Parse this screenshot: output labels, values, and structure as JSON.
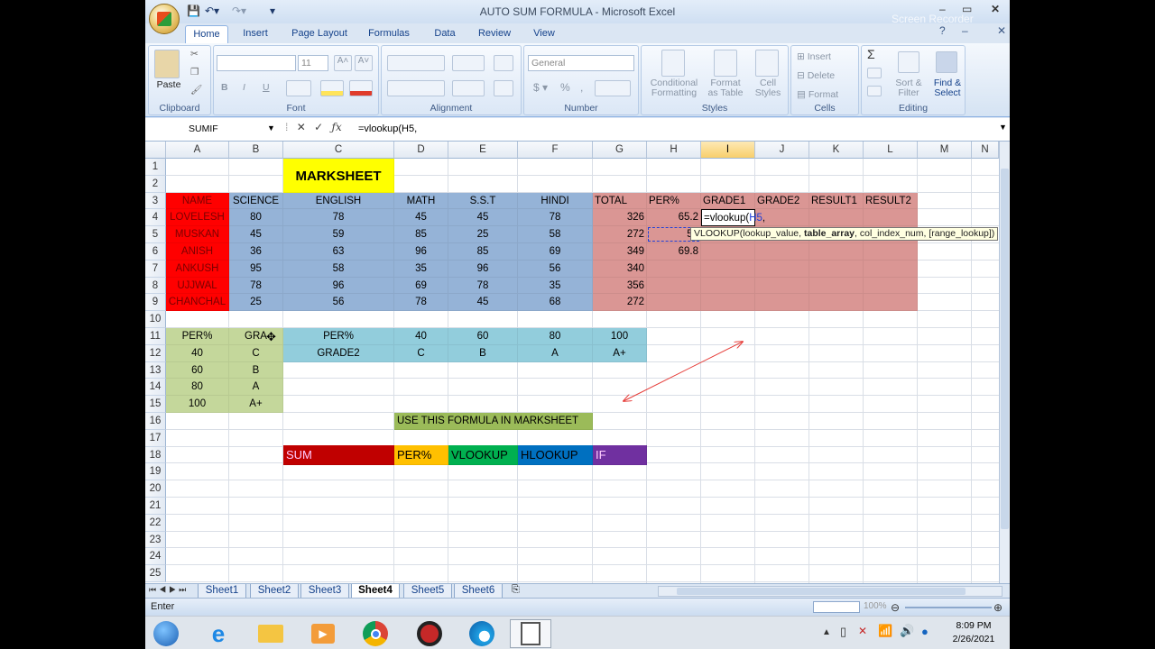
{
  "window": {
    "title": "AUTO SUM FORMULA - Microsoft Excel",
    "watermark": "Screen Recorder"
  },
  "tabs": [
    "Home",
    "Insert",
    "Page Layout",
    "Formulas",
    "Data",
    "Review",
    "View"
  ],
  "ribbon": {
    "clipboard": {
      "label": "Clipboard",
      "paste": "Paste"
    },
    "font": {
      "label": "Font",
      "size": "11",
      "bold": "B",
      "italic": "I",
      "underline": "U"
    },
    "alignment": {
      "label": "Alignment"
    },
    "number": {
      "label": "Number",
      "format": "General"
    },
    "styles": {
      "label": "Styles",
      "conditional": "Conditional Formatting",
      "format_table": "Format as Table",
      "cell_styles": "Cell Styles"
    },
    "cells": {
      "label": "Cells",
      "insert": "Insert",
      "delete": "Delete",
      "format": "Format"
    },
    "editing": {
      "label": "Editing",
      "sort": "Sort & Filter",
      "find": "Find & Select"
    }
  },
  "formula_bar": {
    "name_box": "SUMIF",
    "formula": "=vlookup(H5,"
  },
  "columns": [
    "A",
    "B",
    "C",
    "D",
    "E",
    "F",
    "G",
    "H",
    "I",
    "J",
    "K",
    "L",
    "M",
    "N"
  ],
  "rows": [
    "1",
    "2",
    "3",
    "4",
    "5",
    "6",
    "7",
    "8",
    "9",
    "10",
    "11",
    "12",
    "13",
    "14",
    "15",
    "16",
    "17",
    "18",
    "19",
    "20",
    "21",
    "22",
    "23",
    "24",
    "25"
  ],
  "cells": {
    "title": "MARKSHEET",
    "headers": [
      "NAME",
      "SCIENCE",
      "ENGLISH",
      "MATH",
      "S.S.T",
      "HINDI",
      "TOTAL",
      "PER%",
      "GRADE1",
      "GRADE2",
      "RESULT1",
      "RESULT2"
    ],
    "students": [
      {
        "name": "LOVELESH",
        "marks": [
          "80",
          "78",
          "45",
          "45",
          "78"
        ],
        "total": "326",
        "per": "65.2"
      },
      {
        "name": "MUSKAN",
        "marks": [
          "45",
          "59",
          "85",
          "25",
          "58"
        ],
        "total": "272",
        "per": "54"
      },
      {
        "name": "ANISH",
        "marks": [
          "36",
          "63",
          "96",
          "85",
          "69"
        ],
        "total": "349",
        "per": "69.8"
      },
      {
        "name": "ANKUSH",
        "marks": [
          "95",
          "58",
          "35",
          "96",
          "56"
        ],
        "total": "340",
        "per": ""
      },
      {
        "name": "UJJWAL",
        "marks": [
          "78",
          "96",
          "69",
          "78",
          "35"
        ],
        "total": "356",
        "per": ""
      },
      {
        "name": "CHANCHAL",
        "marks": [
          "25",
          "56",
          "78",
          "45",
          "68"
        ],
        "total": "272",
        "per": ""
      }
    ],
    "editing_cell": {
      "prefix": "=vlookup(",
      "ref": "H5",
      "suffix": ","
    },
    "lookup_v": {
      "header": [
        "PER%",
        "GRA"
      ],
      "rows": [
        [
          "40",
          "C"
        ],
        [
          "60",
          "B"
        ],
        [
          "80",
          "A"
        ],
        [
          "100",
          "A+"
        ]
      ]
    },
    "lookup_h": {
      "row1": [
        "PER%",
        "40",
        "60",
        "80",
        "100"
      ],
      "row2": [
        "GRADE2",
        "C",
        "B",
        "A",
        "A+"
      ]
    },
    "note": "USE THIS FORMULA IN MARKSHEET",
    "legend": [
      "SUM",
      "PER%",
      "VLOOKUP",
      "HLOOKUP",
      "IF"
    ]
  },
  "tooltip": {
    "pre": "VLOOKUP(lookup_value, ",
    "bold": "table_array",
    "post": ", col_index_num, [range_lookup])"
  },
  "sheet_tabs": [
    "Sheet1",
    "Sheet2",
    "Sheet3",
    "Sheet4",
    "Sheet5",
    "Sheet6"
  ],
  "active_sheet": "Sheet4",
  "status": {
    "mode": "Enter",
    "zoom": "100%"
  },
  "clock": {
    "time": "8:09 PM",
    "date": "2/26/2021"
  },
  "colors": {
    "red": "#ff0000",
    "blue": "#95b3d7",
    "pink": "#da9694",
    "green": "#c4d79b",
    "teal": "#92cddc",
    "yellow": "#ffff00",
    "olive": "#9bbb59"
  }
}
